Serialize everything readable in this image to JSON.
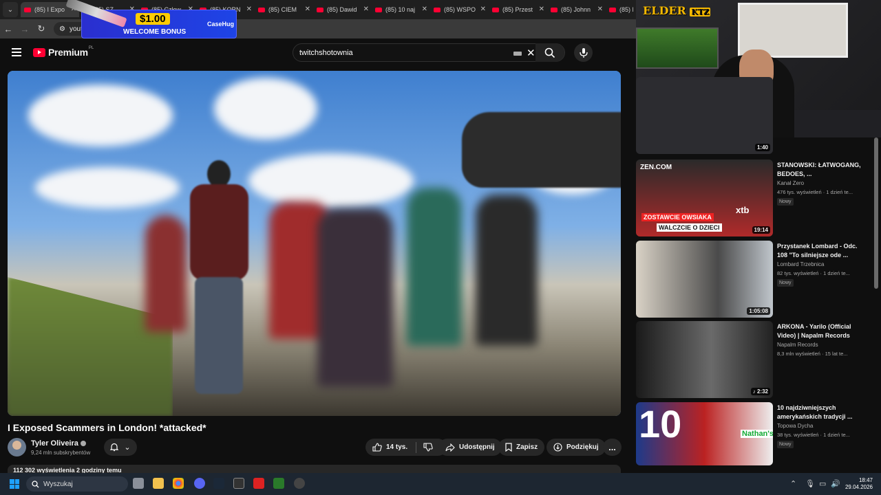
{
  "browser": {
    "tabs": [
      "(85) I Expo",
      "(85) SZ",
      "(85) Człow",
      "(85) KORN",
      "(85) CIEM",
      "(85) Dawid",
      "(85) 10 naj",
      "(85) WSPO",
      "(85) Przest",
      "(85) Johnn",
      "(85) M"
    ],
    "url": "youtube"
  },
  "ad": {
    "amount": "$1.00",
    "bonus": "WELCOME BONUS",
    "brand": "CaseHug"
  },
  "youtube": {
    "logo": "Premium",
    "logo_region": "PL",
    "search_query": "twitchshotownia"
  },
  "video": {
    "title": "I Exposed Scammers in London! *attacked*",
    "channel": "Tyler Oliveira",
    "subscribers": "9,24 mln subskrybentów",
    "likes": "14 tys.",
    "share_label": "Udostępnij",
    "save_label": "Zapisz",
    "thanks_label": "Podziękuj",
    "more_label": "...",
    "description_stats": "112 302 wyświetlenia  2 godziny temu"
  },
  "webcam": {
    "overlay_logo": "ELDER",
    "overlay_badge": "KTZ"
  },
  "recommendations": [
    {
      "title": "",
      "channel": "",
      "meta": "",
      "duration": "1:40",
      "badge": ""
    },
    {
      "title": "STANOWSKI: ŁATWOGANG, BEDOES, ...",
      "channel": "Kanał Zero",
      "meta": "476 tys. wyświetleń · 1 dzień te...",
      "duration": "19:14",
      "badge": "Nowy",
      "thumb_text_1": "ZOSTAWCIE OWSIAKA",
      "thumb_text_2": "WALCZCIE O DZIECI",
      "thumb_logo": "ZEN.COM",
      "thumb_brand": "xtb"
    },
    {
      "title": "Przystanek Lombard - Odc. 108 \"To silniejsze ode ...",
      "channel": "Lombard Trzebnica",
      "meta": "82 tys. wyświetleń · 1 dzień te...",
      "duration": "1:05:08",
      "badge": "Nowy"
    },
    {
      "title": "ARKONA - Yarilo (Official Video) | Napalm Records",
      "channel": "Napalm Records",
      "meta": "8,3 mln wyświetleń · 15 lat te...",
      "duration": "2:32",
      "badge": ""
    },
    {
      "title": "10 najdziwniejszych amerykańskich tradycji ...",
      "channel": "Topowa Dycha",
      "meta": "38 tys. wyświetleń · 1 dzień te...",
      "duration": "",
      "badge": "Nowy",
      "thumb_text_1": "10",
      "thumb_brand": "Nathan's"
    }
  ],
  "taskbar": {
    "search_placeholder": "Wyszukaj",
    "time": "18:47",
    "date": "29.04.2026"
  }
}
